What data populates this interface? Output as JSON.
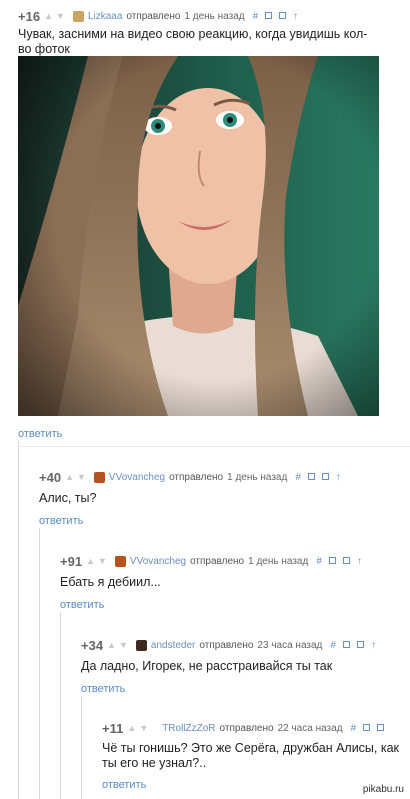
{
  "vote_up_icon": "triangle-up",
  "vote_down_icon": "triangle-down",
  "comments": [
    {
      "rating": "+16",
      "author": "Lizkaaa",
      "posted": "отправлено",
      "time": "1 день назад",
      "text": "Чувак, засними на видео свою реакцию, когда увидишь кол-во фоток",
      "reply": "ответить",
      "link_icon": "#",
      "save_icon": "save",
      "parent_icon": "↑"
    },
    {
      "rating": "+40",
      "author": "VVovancheg",
      "posted": "отправлено",
      "time": "1 день назад",
      "text": "Алис, ты?",
      "reply": "ответить",
      "link_icon": "#",
      "save_icon": "save",
      "parent_icon": "↑"
    },
    {
      "rating": "+91",
      "author": "VVovancheg",
      "posted": "отправлено",
      "time": "1 день назад",
      "text": "Ебать я дебиил...",
      "reply": "ответить",
      "link_icon": "#",
      "save_icon": "save",
      "parent_icon": "↑"
    },
    {
      "rating": "+34",
      "author": "andsteder",
      "posted": "отправлено",
      "time": "23 часа назад",
      "text": "Да ладно, Игорек, не расстраивайся ты так",
      "reply": "ответить",
      "link_icon": "#",
      "save_icon": "save",
      "parent_icon": "↑"
    },
    {
      "rating": "+11",
      "author": "TRollZzZoR",
      "posted": "отправлено",
      "time": "22 часа назад",
      "text": "Чё ты гонишь? Это же Серёга, дружбан Алисы, как ты его не узнал?..",
      "reply": "ответить",
      "link_icon": "#",
      "save_icon": "save",
      "parent_icon": "↑"
    }
  ],
  "watermark": "pikabu.ru"
}
